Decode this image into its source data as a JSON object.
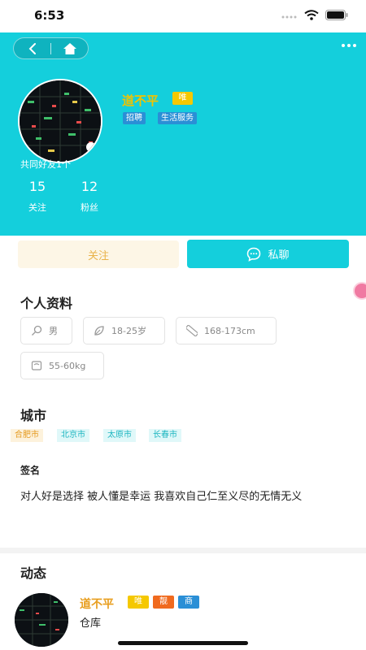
{
  "status_bar": {
    "time": "6:53"
  },
  "profile": {
    "name": "道不平",
    "vip_badge": "唯",
    "tags": [
      "招聘",
      "生活服务"
    ],
    "mutual_friends": "共同好友1个",
    "stats": [
      {
        "value": "15",
        "label": "关注"
      },
      {
        "value": "12",
        "label": "粉丝"
      }
    ]
  },
  "actions": {
    "follow": "关注",
    "chat": "私聊"
  },
  "personal_info": {
    "title": "个人资料",
    "items": [
      {
        "icon": "gender-icon",
        "value": "男"
      },
      {
        "icon": "leaf-icon",
        "value": "18-25岁"
      },
      {
        "icon": "ruler-icon",
        "value": "168-173cm"
      },
      {
        "icon": "scale-icon",
        "value": "55-60kg"
      }
    ]
  },
  "city": {
    "title": "城市",
    "cities": [
      "合肥市",
      "北京市",
      "太原市",
      "长春市"
    ]
  },
  "signature": {
    "label": "签名",
    "text": "对人好是选择 被人懂是幸运 我喜欢自己仁至义尽的无情无义"
  },
  "moments": {
    "title": "动态",
    "post": {
      "author": "道不平",
      "badges": [
        "唯",
        "靓",
        "商"
      ],
      "text": "仓库"
    }
  },
  "colors": {
    "accent": "#14cfdc",
    "vip": "#f5c800",
    "tag_blue": "#2a8fd6",
    "follow_text": "#e9b34a"
  }
}
